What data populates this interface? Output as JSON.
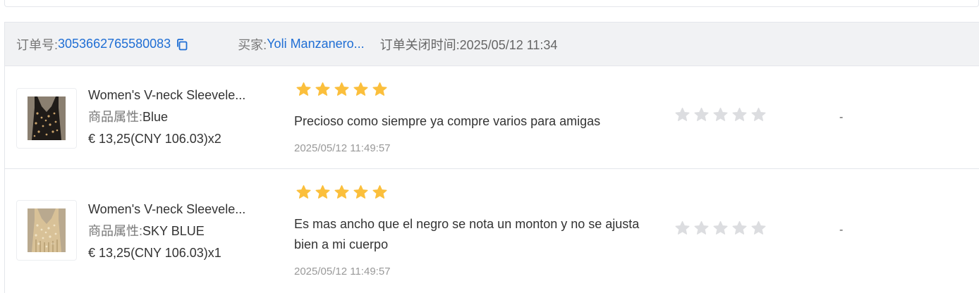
{
  "order": {
    "order_no_label": "订单号:",
    "order_no": "3053662765580083",
    "buyer_label": "买家:",
    "buyer_name": "Yoli Manzanero...",
    "close_time_label": "订单关闭时间:",
    "close_time": "2025/05/12 11:34"
  },
  "items": [
    {
      "name": "Women's V-neck Sleevele...",
      "attr_label": "商品属性:",
      "attr_value": "Blue",
      "price": "€ 13,25",
      "cny": "(CNY  106.03)",
      "qty": "x2",
      "rating": 5,
      "review": "Precioso como siempre ya compre varios para amigas",
      "review_time": "2025/05/12 11:49:57",
      "seller_rating": 0,
      "reply": "-"
    },
    {
      "name": "Women's V-neck Sleevele...",
      "attr_label": "商品属性:",
      "attr_value": "SKY BLUE",
      "price": "€ 13,25",
      "cny": "(CNY  106.03)",
      "qty": "x1",
      "rating": 5,
      "review": "Es mas ancho que el negro se nota un monton y no se ajusta bien a mi cuerpo",
      "review_time": "2025/05/12 11:49:57",
      "seller_rating": 0,
      "reply": "-"
    }
  ],
  "colors": {
    "link": "#1f6ed4",
    "star_filled": "#fbbf3c",
    "star_empty": "#dcdde0",
    "header_bg": "#f1f2f4"
  },
  "icons": {
    "copy": "copy-icon",
    "star": "star-icon"
  }
}
